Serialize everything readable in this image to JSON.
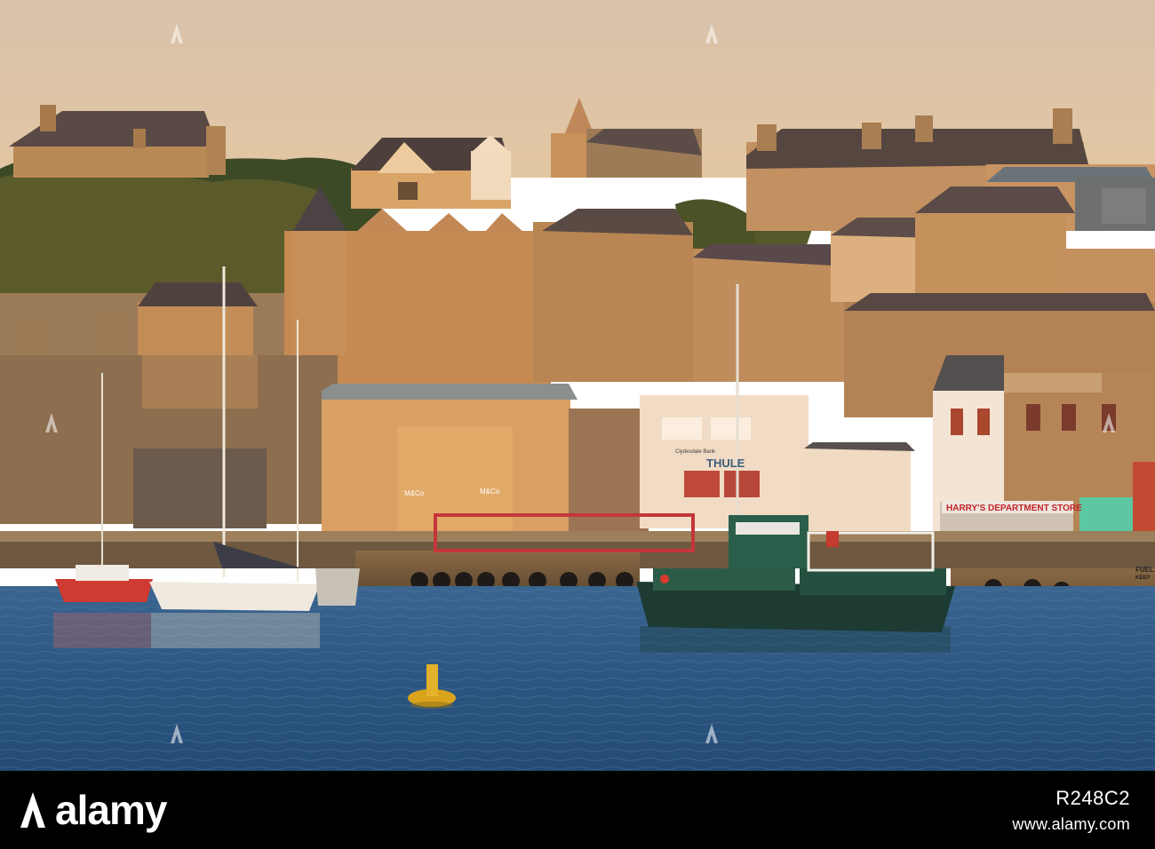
{
  "photo": {
    "sky_color": "#dcc3a6",
    "water_color": "#2f5a84",
    "stone_color": "#c8935a",
    "signs": {
      "store_name": "HARRY'S DEPARTMENT STORE",
      "thule": "THULE",
      "mandco_left": "M&Co",
      "mandco_right": "M&Co",
      "bank": "Clydesdale Bank",
      "fuel": "FUEL",
      "keep": "KEEP"
    }
  },
  "footer": {
    "brand": "alamy",
    "image_id": "R248C2",
    "url": "www.alamy.com"
  }
}
